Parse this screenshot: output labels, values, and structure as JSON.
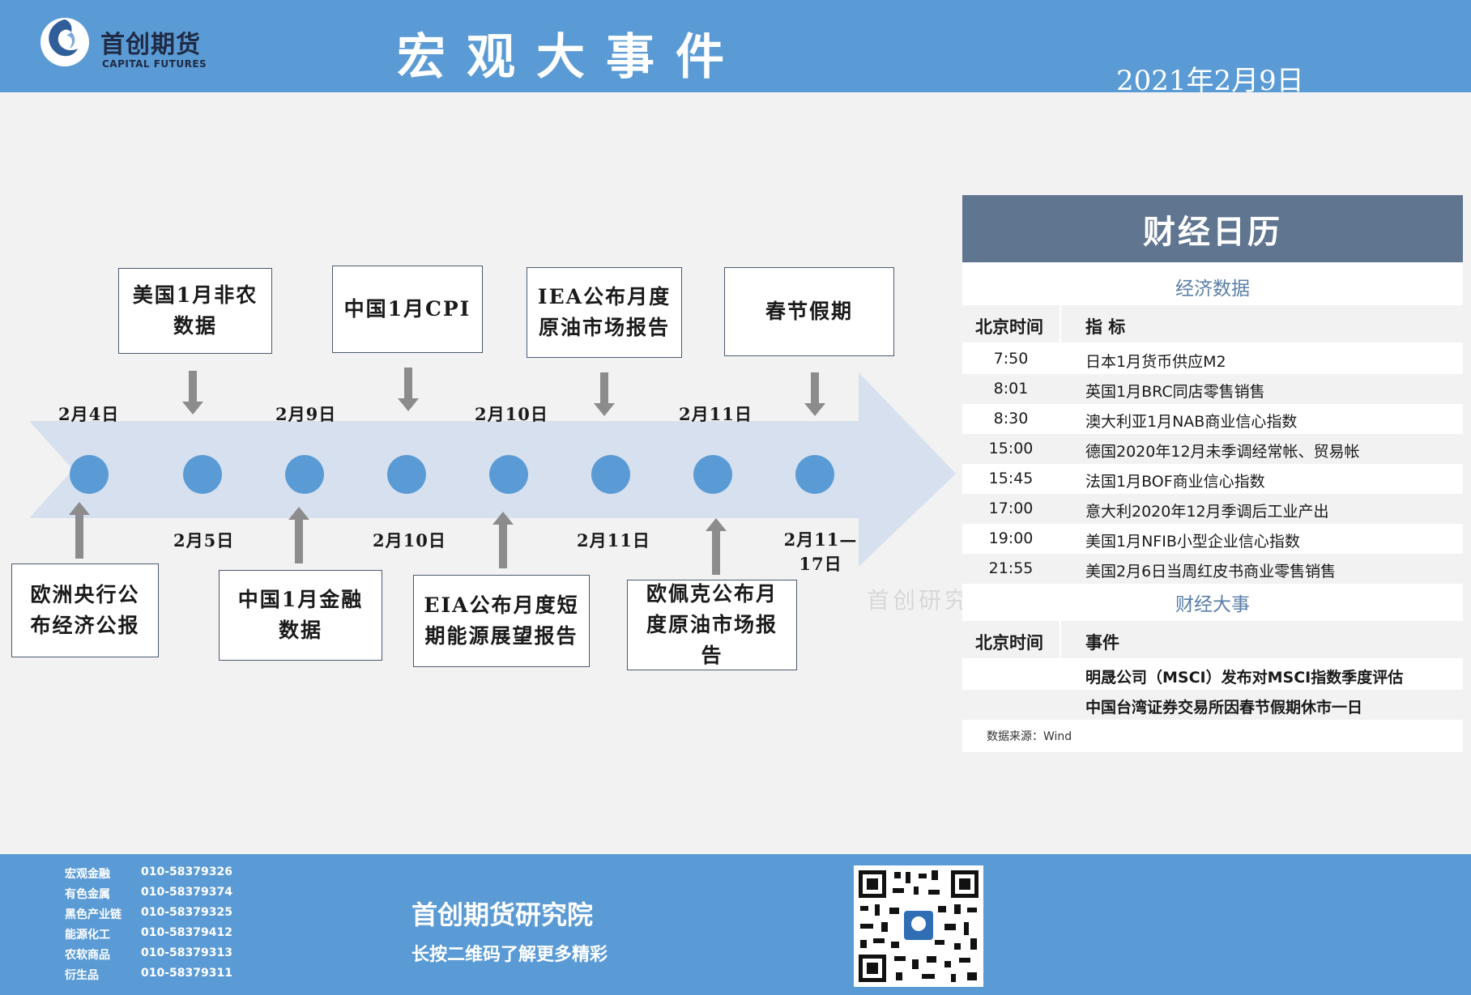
{
  "header": {
    "brand_cn": "首创期货",
    "brand_en": "CAPITAL FUTURES",
    "title": "宏观大事件",
    "date": "2021年2月9日"
  },
  "timeline": {
    "top_events": [
      {
        "label": "美国1月非农数据"
      },
      {
        "label": "中国1月CPI"
      },
      {
        "label": "IEA公布月度原油市场报告"
      },
      {
        "label": "春节假期"
      }
    ],
    "top_dates": [
      "2月4日",
      "2月9日",
      "2月10日",
      "2月11日"
    ],
    "bottom_dates": [
      "2月5日",
      "2月10日",
      "2月11日",
      "2月11—17日"
    ],
    "bottom_events": [
      {
        "label": "欧洲央行公布经济公报"
      },
      {
        "label": "中国1月金融数据"
      },
      {
        "label": "EIA公布月度短期能源展望报告"
      },
      {
        "label": "欧佩克公布月度原油市场报告"
      }
    ]
  },
  "calendar": {
    "title": "财经日历",
    "section1": "经济数据",
    "col_time": "北京时间",
    "col_indicator": "指  标",
    "data_rows": [
      {
        "time": "7:50",
        "event": "日本1月货币供应M2"
      },
      {
        "time": "8:01",
        "event": "英国1月BRC同店零售销售"
      },
      {
        "time": "8:30",
        "event": "澳大利亚1月NAB商业信心指数"
      },
      {
        "time": "15:00",
        "event": "德国2020年12月未季调经常帐、贸易帐"
      },
      {
        "time": "15:45",
        "event": "法国1月BOF商业信心指数"
      },
      {
        "time": "17:00",
        "event": "意大利2020年12月季调后工业产出"
      },
      {
        "time": "19:00",
        "event": "美国1月NFIB小型企业信心指数"
      },
      {
        "time": "21:55",
        "event": "美国2月6日当周红皮书商业零售销售"
      }
    ],
    "section2": "财经大事",
    "col_time2": "北京时间",
    "col_event": "事件",
    "event_rows": [
      {
        "time": "",
        "event": "明晟公司（MSCI）发布对MSCI指数季度评估"
      },
      {
        "time": "",
        "event": "中国台湾证券交易所因春节假期休市一日"
      }
    ],
    "source": "数据来源：Wind"
  },
  "watermark": "首创研究",
  "footer": {
    "contacts": [
      {
        "dept": "宏观金融",
        "phone": "010-58379326"
      },
      {
        "dept": "有色金属",
        "phone": "010-58379374"
      },
      {
        "dept": "黑色产业链",
        "phone": "010-58379325"
      },
      {
        "dept": "能源化工",
        "phone": "010-58379412"
      },
      {
        "dept": "农软商品",
        "phone": "010-58379313"
      },
      {
        "dept": "衍生品",
        "phone": "010-58379311"
      }
    ],
    "org": "首创期货研究院",
    "slogan": "长按二维码了解更多精彩"
  },
  "colors": {
    "header_blue": "#5b9bd5",
    "arrow_fill": "#d6e0ee",
    "node_blue": "#5b9bd5",
    "calendar_header": "#5f7590"
  }
}
